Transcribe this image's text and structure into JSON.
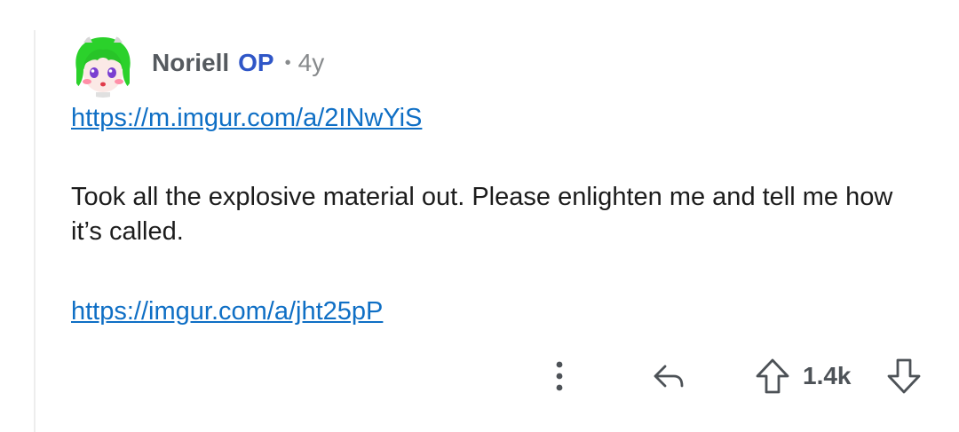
{
  "comment": {
    "author": "Noriell",
    "op_badge": "OP",
    "separator": "•",
    "age": "4y",
    "link_1": "https://m.imgur.com/a/2INwYiS",
    "body": "Took all the explosive material out. Please enlighten me and tell me how it’s called.",
    "link_2": "https://imgur.com/a/jht25pP"
  },
  "actions": {
    "more_icon": "vertical-ellipsis-icon",
    "reply_icon": "reply-arrow-icon",
    "upvote_icon": "upvote-arrow-icon",
    "score": "1.4k",
    "downvote_icon": "downvote-arrow-icon"
  },
  "colors": {
    "link": "#0f6fc5",
    "op_badge": "#2f56c7",
    "avatar_hair": "#2bd12b",
    "thread_line": "#ededed"
  }
}
